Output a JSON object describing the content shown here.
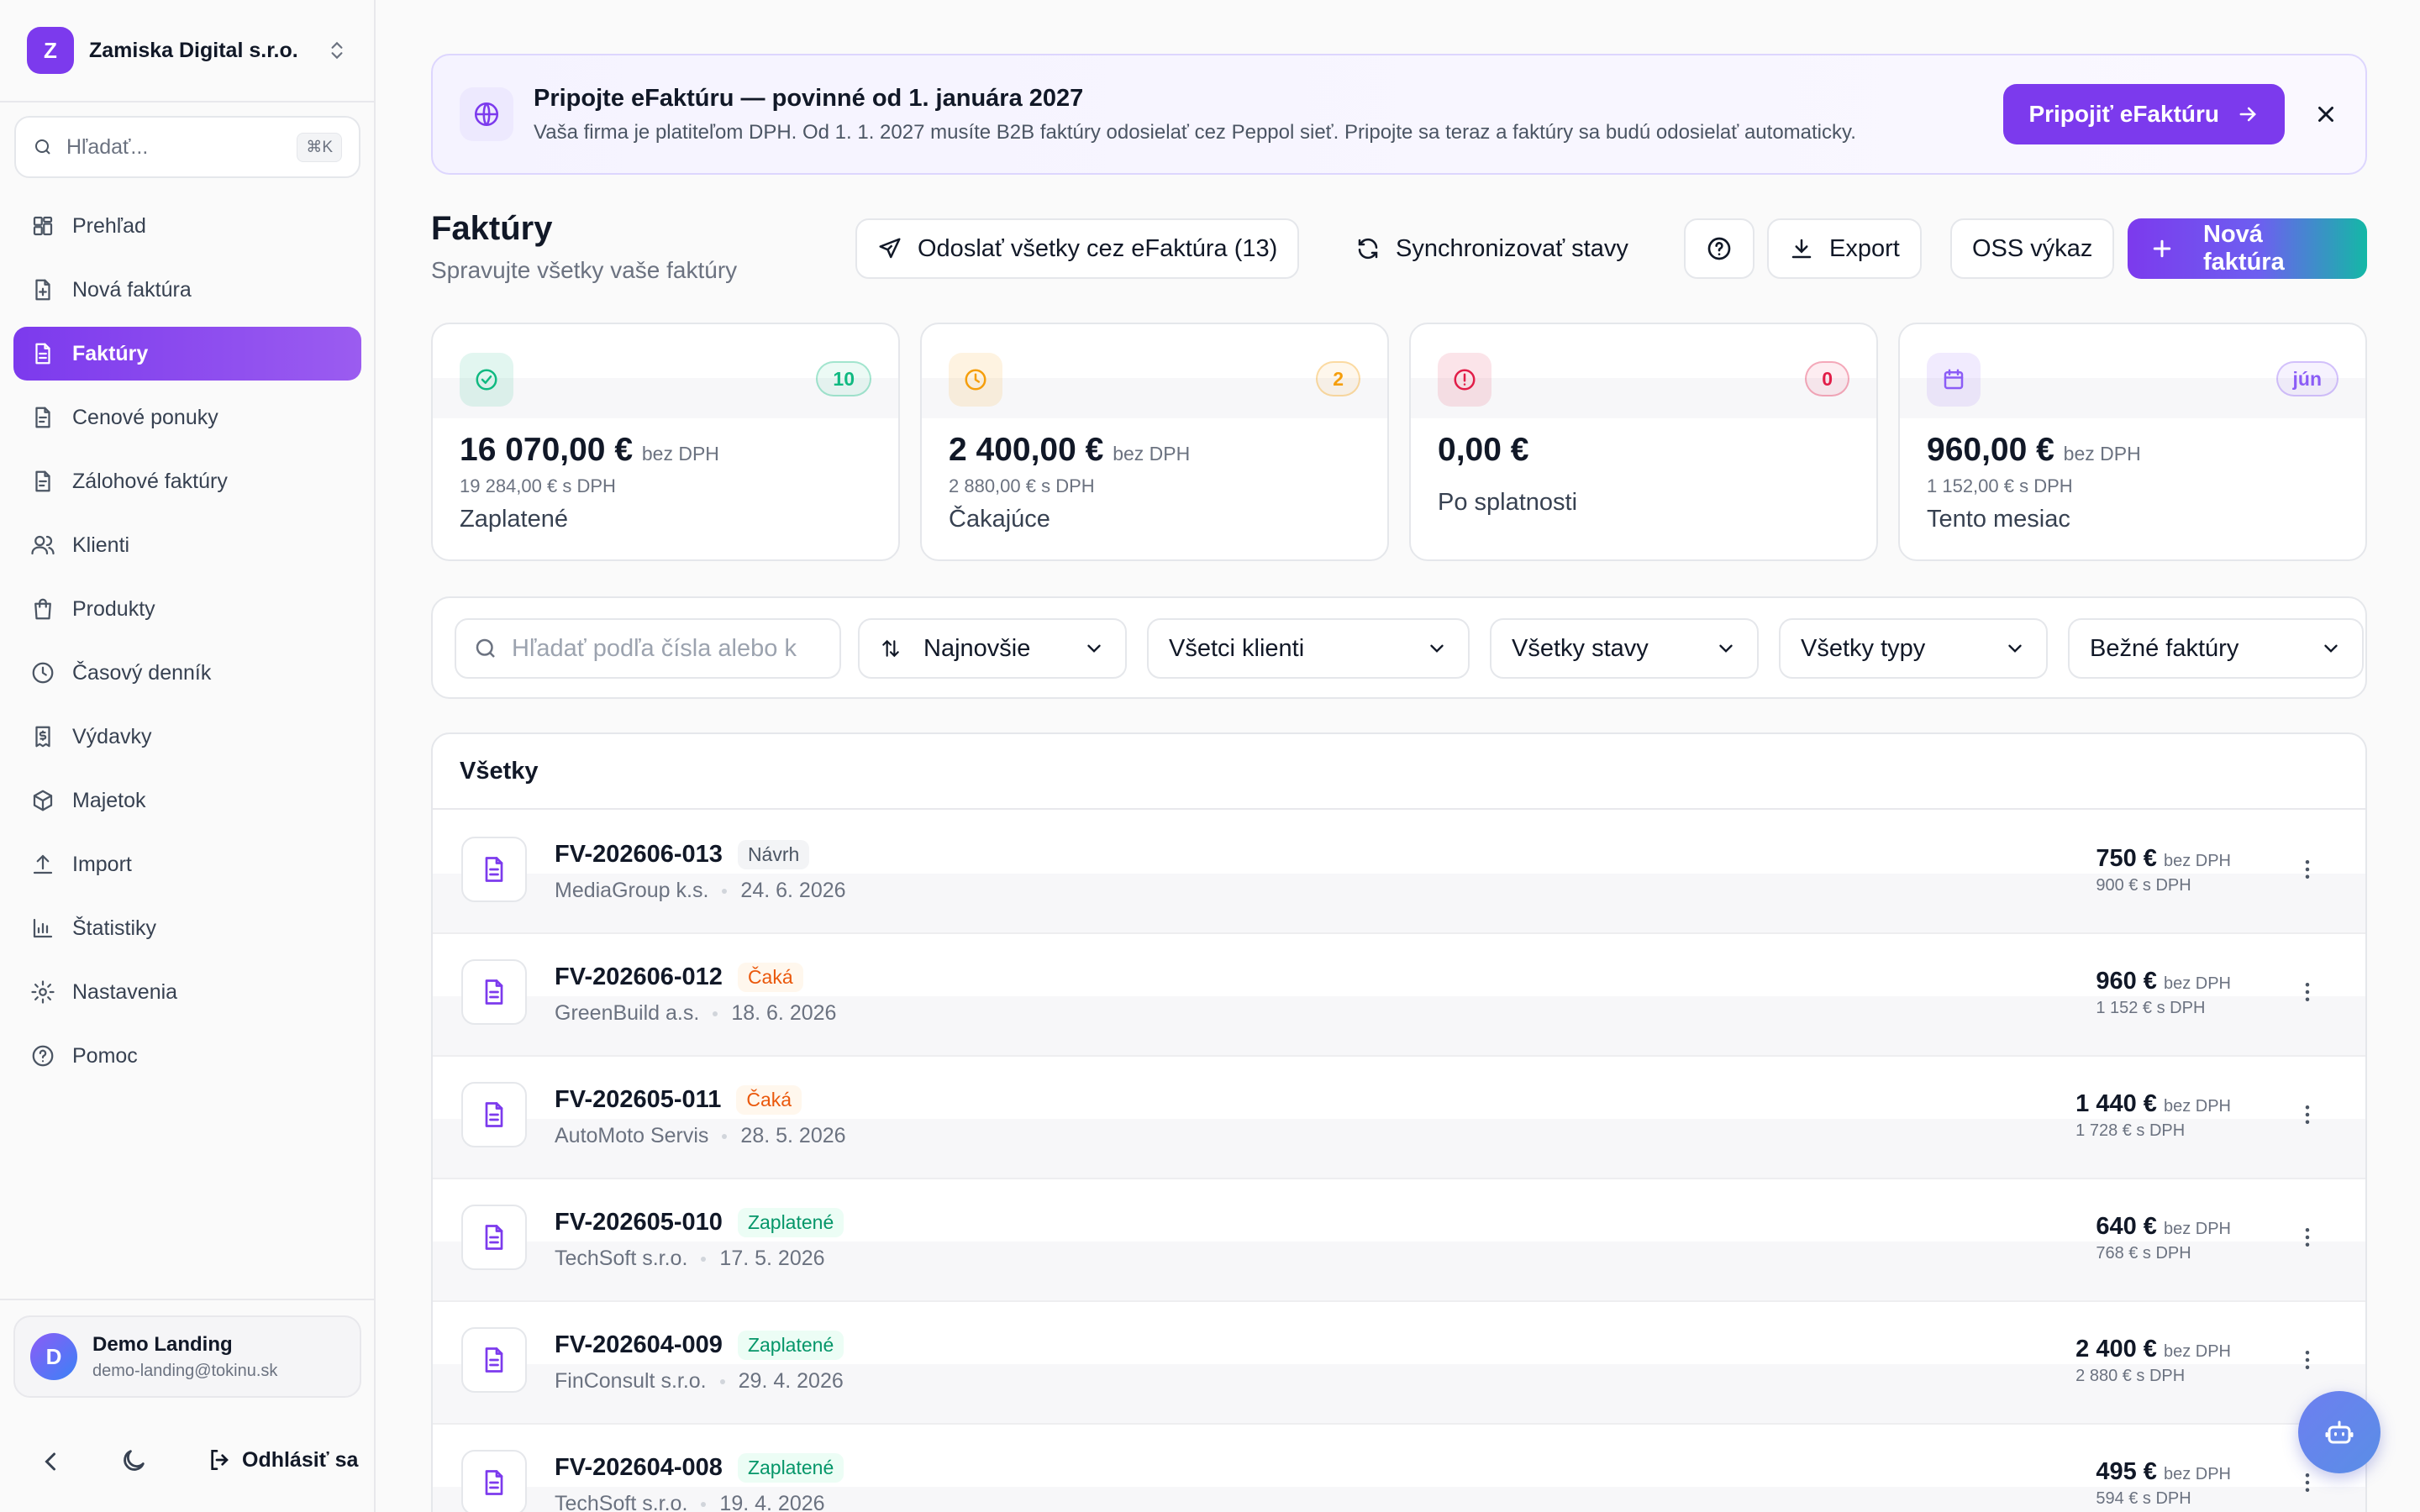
{
  "workspace": {
    "initial": "Z",
    "name": "Zamiska Digital s.r.o."
  },
  "search": {
    "placeholder": "Hľadať...",
    "shortcut": "⌘K"
  },
  "nav": [
    {
      "label": "Prehľad",
      "icon": "dashboard-icon"
    },
    {
      "label": "Nová faktúra",
      "icon": "file-plus-icon"
    },
    {
      "label": "Faktúry",
      "icon": "file-text-icon",
      "active": true
    },
    {
      "label": "Cenové ponuky",
      "icon": "file-icon"
    },
    {
      "label": "Zálohové faktúry",
      "icon": "file-icon"
    },
    {
      "label": "Klienti",
      "icon": "users-icon"
    },
    {
      "label": "Produkty",
      "icon": "shopping-bag-icon"
    },
    {
      "label": "Časový denník",
      "icon": "clock-icon"
    },
    {
      "label": "Výdavky",
      "icon": "receipt-icon"
    },
    {
      "label": "Majetok",
      "icon": "package-icon"
    },
    {
      "label": "Import",
      "icon": "upload-icon"
    },
    {
      "label": "Štatistiky",
      "icon": "bar-chart-icon"
    },
    {
      "label": "Nastavenia",
      "icon": "gear-icon"
    },
    {
      "label": "Pomoc",
      "icon": "help-circle-icon"
    }
  ],
  "user": {
    "initial": "D",
    "name": "Demo Landing",
    "email": "demo-landing@tokinu.sk"
  },
  "footer": {
    "logout": "Odhlásiť sa"
  },
  "banner": {
    "title": "Pripojte eFaktúru — povinné od 1. januára 2027",
    "desc": "Vaša firma je platiteľom DPH. Od 1. 1. 2027 musíte B2B faktúry odosielať cez Peppol sieť. Pripojte sa teraz a faktúry sa budú odosielať automaticky.",
    "button": "Pripojiť eFaktúru"
  },
  "page": {
    "title": "Faktúry",
    "subtitle": "Spravujte všetky vaše faktúry"
  },
  "toolbar": {
    "send_all": "Odoslať všetky cez eFaktúra (13)",
    "sync": "Synchronizovať stavy",
    "export": "Export",
    "oss": "OSS výkaz",
    "new_invoice": "Nová faktúra"
  },
  "stats": [
    {
      "amount": "16 070,00 €",
      "suffix": "bez DPH",
      "secondary": "19 284,00 € s DPH",
      "label": "Zaplatené",
      "count": "10",
      "color": "#10b981",
      "icon": "check-circle-icon"
    },
    {
      "amount": "2 400,00 €",
      "suffix": "bez DPH",
      "secondary": "2 880,00 € s DPH",
      "label": "Čakajúce",
      "count": "2",
      "color": "#f59e0b",
      "icon": "clock-icon"
    },
    {
      "amount": "0,00 €",
      "suffix": "",
      "secondary": "",
      "label": "Po splatnosti",
      "count": "0",
      "color": "#e11d48",
      "icon": "alert-circle-icon"
    },
    {
      "amount": "960,00 €",
      "suffix": "bez DPH",
      "secondary": "1 152,00 € s DPH",
      "label": "Tento mesiac",
      "count": "jún",
      "color": "#8b5cf6",
      "icon": "calendar-icon"
    }
  ],
  "filters": {
    "search_placeholder": "Hľadať podľa čísla alebo k",
    "sort": "Najnovšie",
    "clients": "Všetci klienti",
    "states": "Všetky stavy",
    "types": "Všetky typy",
    "kind": "Bežné faktúry"
  },
  "list": {
    "header": "Všetky",
    "rows": [
      {
        "number": "FV-202606-013",
        "status": "Návrh",
        "status_type": "draft",
        "client": "MediaGroup k.s.",
        "date": "24. 6. 2026",
        "net": "750 €",
        "net_suffix": "bez DPH",
        "gross": "900 € s DPH"
      },
      {
        "number": "FV-202606-012",
        "status": "Čaká",
        "status_type": "wait",
        "client": "GreenBuild a.s.",
        "date": "18. 6. 2026",
        "net": "960 €",
        "net_suffix": "bez DPH",
        "gross": "1 152 € s DPH"
      },
      {
        "number": "FV-202605-011",
        "status": "Čaká",
        "status_type": "wait",
        "client": "AutoMoto Servis",
        "date": "28. 5. 2026",
        "net": "1 440 €",
        "net_suffix": "bez DPH",
        "gross": "1 728 € s DPH"
      },
      {
        "number": "FV-202605-010",
        "status": "Zaplatené",
        "status_type": "paid",
        "client": "TechSoft s.r.o.",
        "date": "17. 5. 2026",
        "net": "640 €",
        "net_suffix": "bez DPH",
        "gross": "768 € s DPH"
      },
      {
        "number": "FV-202604-009",
        "status": "Zaplatené",
        "status_type": "paid",
        "client": "FinConsult s.r.o.",
        "date": "29. 4. 2026",
        "net": "2 400 €",
        "net_suffix": "bez DPH",
        "gross": "2 880 € s DPH"
      },
      {
        "number": "FV-202604-008",
        "status": "Zaplatené",
        "status_type": "paid",
        "client": "TechSoft s.r.o.",
        "date": "19. 4. 2026",
        "net": "495 €",
        "net_suffix": "bez DPH",
        "gross": "594 € s DPH"
      }
    ]
  }
}
